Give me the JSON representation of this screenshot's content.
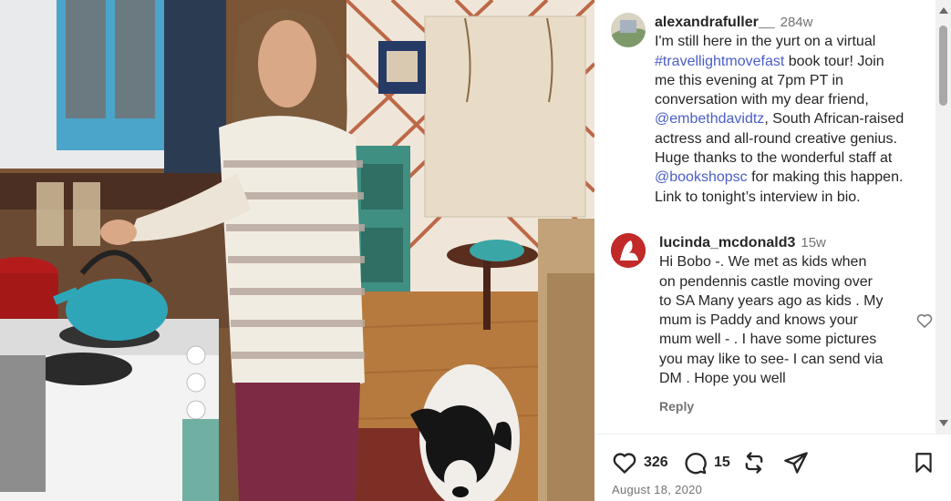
{
  "post": {
    "author": "alexandrafuller__",
    "time": "284w",
    "caption_lines": [
      {
        "pre": "I'm still here in the yurt on a virtual",
        "tag": "",
        "post": ""
      },
      {
        "pre": "",
        "tag": "#travellightmovefast",
        "post": " book tour!  Join"
      },
      {
        "pre": "me this evening at 7pm PT in",
        "tag": "",
        "post": ""
      },
      {
        "pre": "conversation with my dear friend,",
        "tag": "",
        "post": ""
      },
      {
        "pre": "",
        "tag": "@embethdavidtz",
        "post": ", South African-raised"
      },
      {
        "pre": "actress and all-round creative genius.",
        "tag": "",
        "post": ""
      },
      {
        "pre": "Huge thanks to the wonderful staff at",
        "tag": "",
        "post": ""
      },
      {
        "pre": "",
        "tag": "@bookshopsc",
        "post": " for making this happen."
      },
      {
        "pre": "Link to tonight’s interview in bio.",
        "tag": "",
        "post": ""
      }
    ]
  },
  "comment": {
    "author": "lucinda_mcdonald3",
    "time": "15w",
    "text_lines": [
      "Hi Bobo -. We met as kids when",
      "on pendennis castle moving over",
      "to SA Many years ago as kids . My",
      "mum is Paddy and knows your",
      "mum well - . I have some pictures",
      "you may like to see- I can send via",
      "DM . Hope you well"
    ],
    "reply_label": "Reply"
  },
  "actions": {
    "like_count": "326",
    "comment_count": "15",
    "like_icon": "heart-icon",
    "comment_icon": "comment-bubble-icon",
    "repost_icon": "repost-icon",
    "share_icon": "send-icon",
    "save_icon": "bookmark-icon"
  },
  "date": "August 18, 2020",
  "colors": {
    "link": "#4a5dc9",
    "muted": "#737373",
    "text": "#262626",
    "comment_avatar": "#c12a28"
  }
}
